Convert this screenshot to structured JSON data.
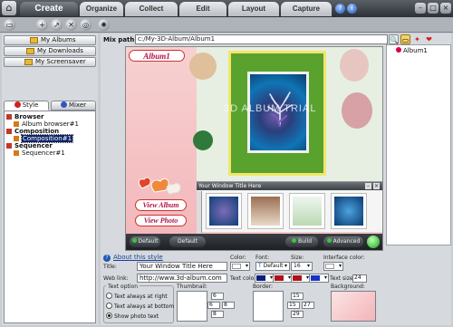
{
  "top_tabs": [
    {
      "label": "Create",
      "active": true
    },
    {
      "label": "Organize",
      "active": false
    },
    {
      "label": "Collect",
      "active": false
    },
    {
      "label": "Edit",
      "active": false
    },
    {
      "label": "Layout",
      "active": false
    },
    {
      "label": "Capture",
      "active": false
    }
  ],
  "left_panel": {
    "buttons": [
      "My Albums",
      "My Downloads",
      "My Screensaver"
    ],
    "tabs": [
      "Style",
      "Mixer"
    ],
    "tree": [
      {
        "label": "Browser",
        "level": 0
      },
      {
        "label": "Album browser#1",
        "level": 1
      },
      {
        "label": "Composition",
        "level": 0
      },
      {
        "label": "Composition#1",
        "level": 1,
        "selected": true
      },
      {
        "label": "Sequencer",
        "level": 0
      },
      {
        "label": "Sequencer#1",
        "level": 1
      }
    ]
  },
  "mix_path": {
    "label": "Mix path",
    "value": "c:/My-3D-Album/Album1"
  },
  "album_list": {
    "items": [
      "Album1"
    ]
  },
  "preview": {
    "album_tag": "Album1",
    "view_album": "View Album",
    "view_photo": "View Photo",
    "watermark": "3D ALBUM TRIAL",
    "strip_title": "Your Window Title Here",
    "player_default1": "Default",
    "player_default2": "Default",
    "player_build": "Build",
    "player_advanced": "Advanced"
  },
  "properties": {
    "about_link": "About this style",
    "title_label": "Title:",
    "title_value": "Your Window Title Here",
    "weblink_label": "Web link:",
    "weblink_value": "http://www.3d-album.com",
    "color_label": "Color:",
    "font_label": "Font:",
    "font_value": "Default",
    "size_label": "Size:",
    "size_value": "16",
    "interface_color_label": "Interface color:",
    "text_color_label": "Text color:",
    "text_size_label": "Text size:",
    "text_size_value": "24",
    "text_option_label": "Text option",
    "text_options": [
      "Text always at right",
      "Text always at bottom",
      "Show photo text"
    ],
    "thumbnail_label": "Thumbnail:",
    "border_label": "Border:",
    "background_label": "Background:",
    "thumb_nums": [
      "6",
      "6",
      "8",
      "8"
    ],
    "border_nums": [
      "15",
      "15",
      "27",
      "29"
    ],
    "colors": {
      "title_color": "#ffffff",
      "text_color_1": "#0a1f7a",
      "text_color_2": "#b11217",
      "text_color_3": "#b11217",
      "text_color_4": "#1533c9",
      "interface_color": "#ffffff",
      "accent_pink": "#b3124a"
    }
  }
}
